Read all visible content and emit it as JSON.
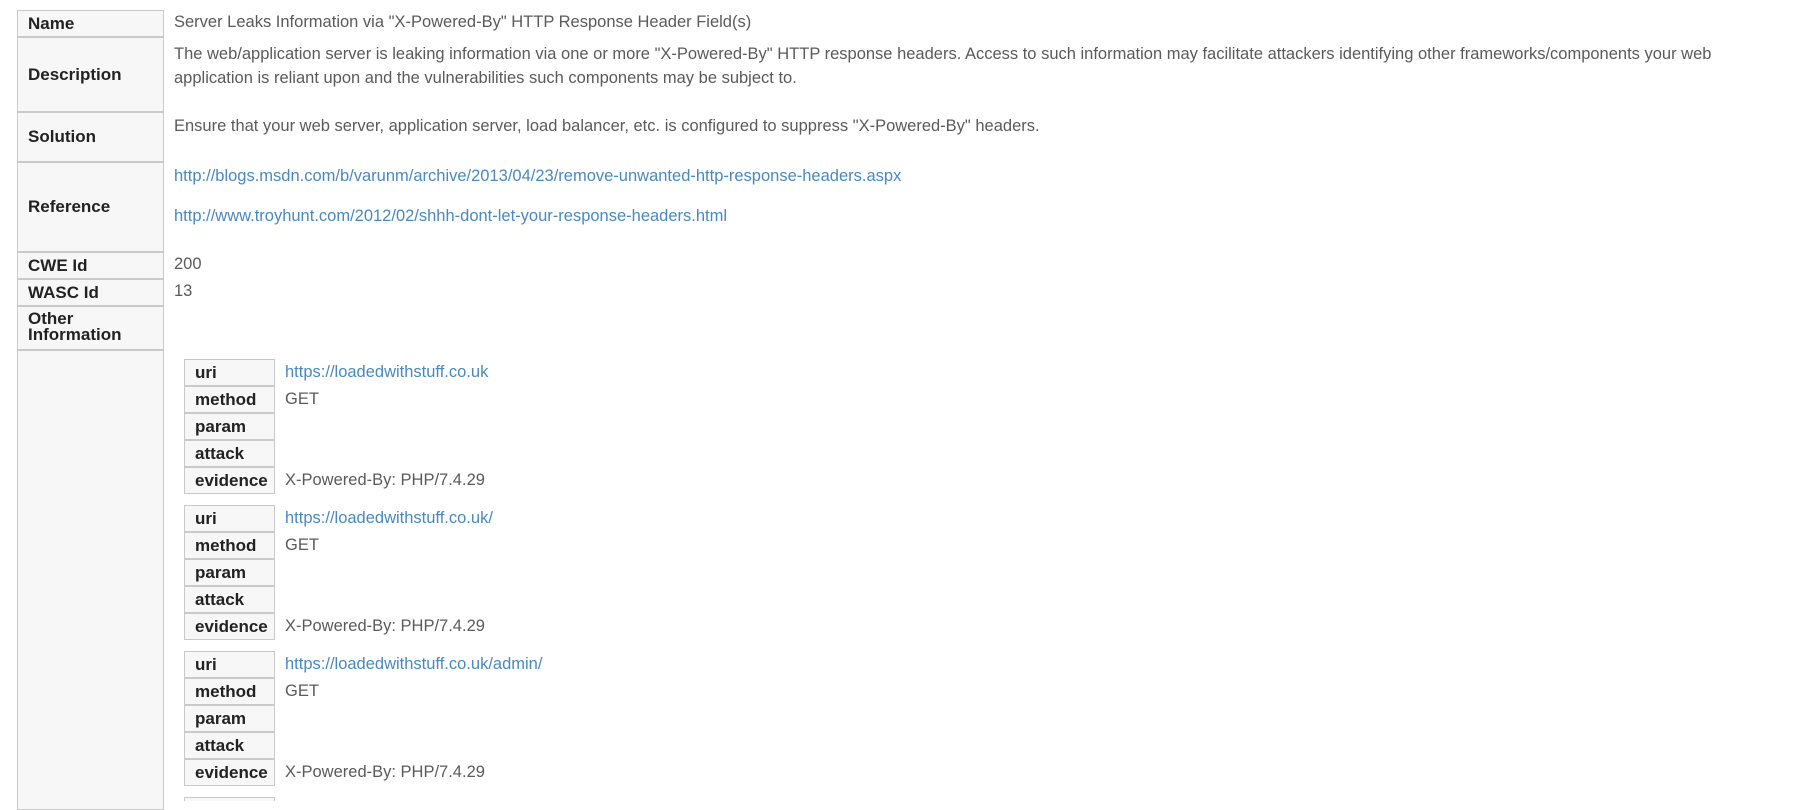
{
  "alert": {
    "name_label": "Name",
    "name": "Server Leaks Information via \"X-Powered-By\" HTTP Response Header Field(s)",
    "description_label": "Description",
    "description": "The web/application server is leaking information via one or more \"X-Powered-By\" HTTP response headers. Access to such information may facilitate attackers identifying other frameworks/components your web application is reliant upon and the vulnerabilities such components may be subject to.",
    "solution_label": "Solution",
    "solution": "Ensure that your web server, application server, load balancer, etc. is configured to suppress \"X-Powered-By\" headers.",
    "reference_label": "Reference",
    "references": [
      "http://blogs.msdn.com/b/varunm/archive/2013/04/23/remove-unwanted-http-response-headers.aspx",
      "http://www.troyhunt.com/2012/02/shhh-dont-let-your-response-headers.html"
    ],
    "cwe_label": "CWE Id",
    "cwe": "200",
    "wasc_label": "WASC Id",
    "wasc": "13",
    "other_label": "Other Information"
  },
  "instance_labels": {
    "uri": "uri",
    "method": "method",
    "param": "param",
    "attack": "attack",
    "evidence": "evidence"
  },
  "instances": [
    {
      "uri": "https://loadedwithstuff.co.uk",
      "method": "GET",
      "param": "",
      "attack": "",
      "evidence": "X-Powered-By: PHP/7.4.29"
    },
    {
      "uri": "https://loadedwithstuff.co.uk/",
      "method": "GET",
      "param": "",
      "attack": "",
      "evidence": "X-Powered-By: PHP/7.4.29"
    },
    {
      "uri": "https://loadedwithstuff.co.uk/admin/",
      "method": "GET",
      "param": "",
      "attack": "",
      "evidence": "X-Powered-By: PHP/7.4.29"
    }
  ]
}
